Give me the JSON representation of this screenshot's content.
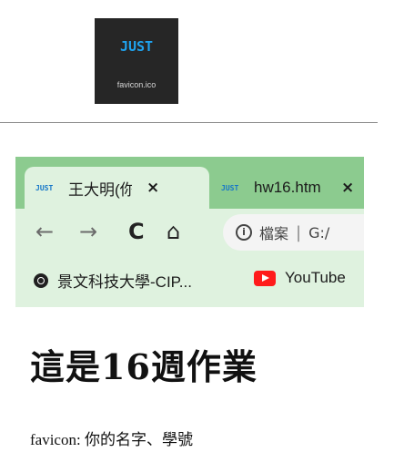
{
  "favicon": {
    "logo_text": "JUST",
    "caption": "favicon.ico"
  },
  "browser": {
    "tabs": [
      {
        "icon_text": "JUST",
        "title": "王大明(你",
        "close": "×"
      },
      {
        "icon_text": "JUST",
        "title": "hw16.htm",
        "close": "×"
      }
    ],
    "toolbar": {
      "back": "←",
      "forward": "→",
      "reload": "C",
      "home": "⌂"
    },
    "omnibox": {
      "info": "i",
      "label": "檔案",
      "separator": "|",
      "url": "G:/"
    },
    "bookmarks": [
      {
        "icon": "globe-icon",
        "label": "景文科技大學-CIP..."
      },
      {
        "icon": "youtube-icon",
        "label": "YouTube"
      }
    ],
    "colors": {
      "tabstrip": "#8ccb8f",
      "toolbar": "#dff2df",
      "youtube": "#ff1b1b"
    }
  },
  "page": {
    "heading": "這是16週作業",
    "caption": "favicon: 你的名字、學號"
  }
}
